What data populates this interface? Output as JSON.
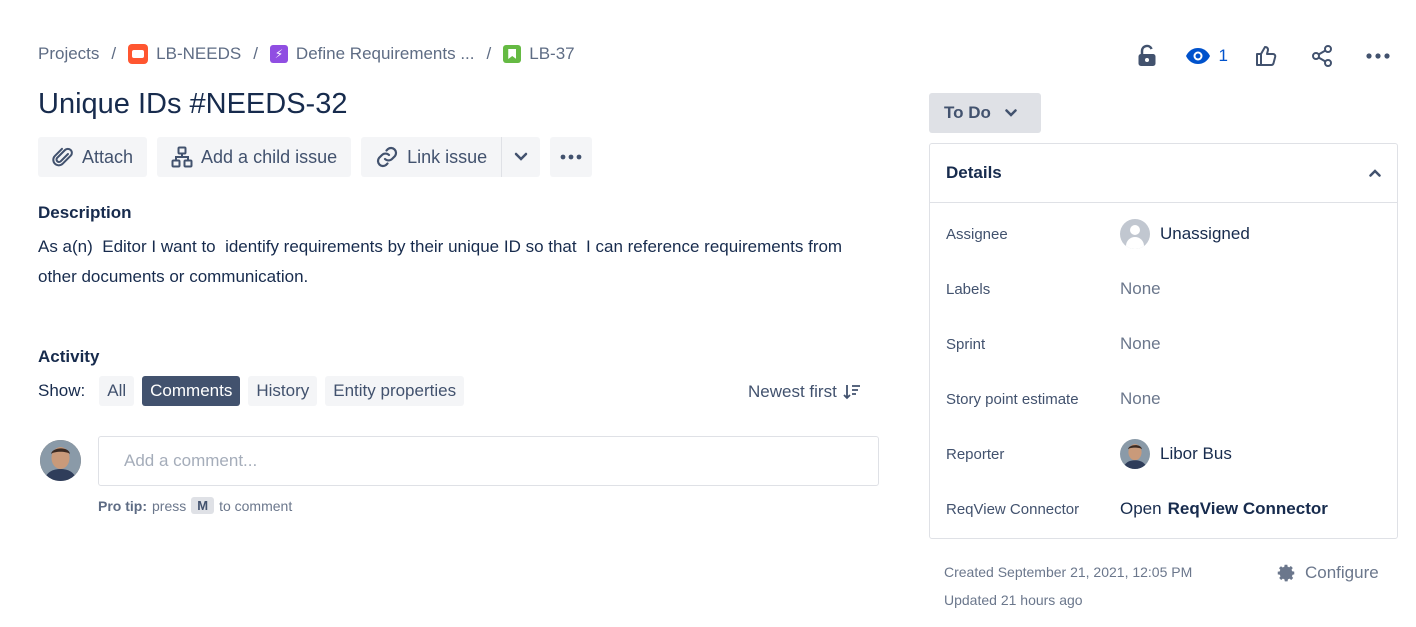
{
  "breadcrumb": {
    "projects": "Projects",
    "project": "LB-NEEDS",
    "epic": "Define Requirements ...",
    "issue": "LB-37",
    "separator": "/"
  },
  "top_actions": {
    "watch_count": "1",
    "icons": [
      "lock-icon",
      "eye-icon",
      "thumbs-up-icon",
      "share-icon",
      "more-icon"
    ]
  },
  "issue": {
    "title": "Unique IDs #NEEDS-32"
  },
  "toolbar": {
    "attach": "Attach",
    "add_child": "Add a child issue",
    "link_issue": "Link issue"
  },
  "description": {
    "heading": "Description",
    "text": "As a(n)  Editor I want to  identify requirements by their unique ID so that  I can reference requirements from other documents or communication."
  },
  "activity": {
    "heading": "Activity",
    "show_label": "Show:",
    "filters": [
      {
        "label": "All",
        "active": false
      },
      {
        "label": "Comments",
        "active": true
      },
      {
        "label": "History",
        "active": false
      },
      {
        "label": "Entity properties",
        "active": false
      }
    ],
    "sort_label": "Newest first",
    "comment_placeholder": "Add a comment...",
    "protip_label": "Pro tip:",
    "protip_press": "press",
    "protip_key": "M",
    "protip_suffix": "to comment"
  },
  "status": {
    "label": "To Do"
  },
  "details": {
    "heading": "Details",
    "assignee_label": "Assignee",
    "assignee_value": "Unassigned",
    "labels_label": "Labels",
    "labels_value": "None",
    "sprint_label": "Sprint",
    "sprint_value": "None",
    "story_points_label": "Story point estimate",
    "story_points_value": "None",
    "reporter_label": "Reporter",
    "reporter_value": "Libor Bus",
    "connector_label": "ReqView Connector",
    "connector_prefix": "Open",
    "connector_link": "ReqView Connector"
  },
  "meta": {
    "created": "Created September 21, 2021, 12:05 PM",
    "updated": "Updated 21 hours ago",
    "configure": "Configure"
  }
}
